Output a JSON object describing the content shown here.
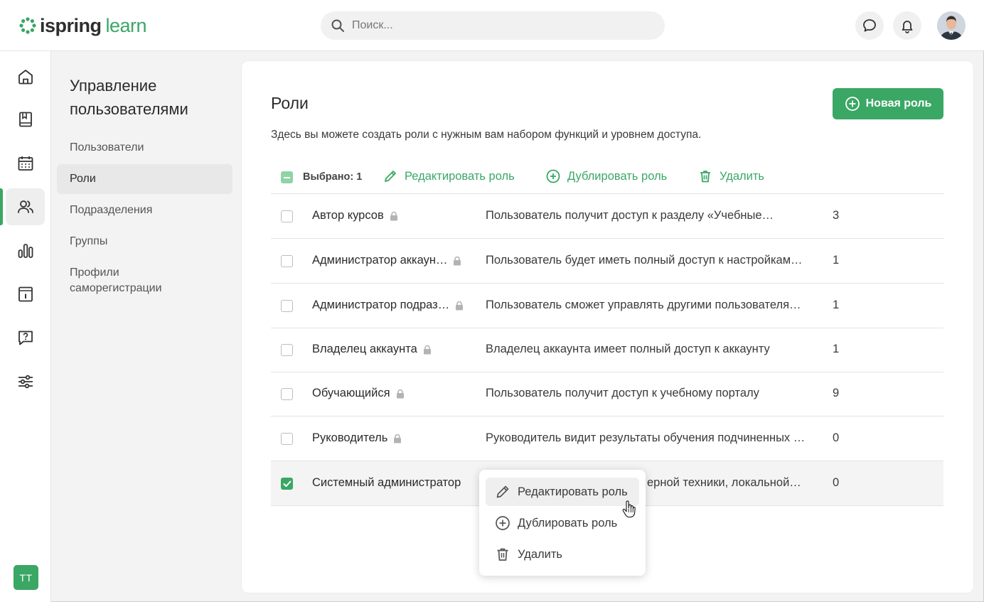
{
  "header": {
    "logo_part1": "ispring",
    "logo_part2": "learn",
    "search_placeholder": "Поиск...",
    "icons": [
      "chat-icon",
      "bell-icon",
      "user-avatar"
    ]
  },
  "rail": {
    "items": [
      "home-icon",
      "book-icon",
      "calendar-icon",
      "users-icon",
      "reports-icon",
      "info-icon",
      "help-icon",
      "settings-sliders-icon"
    ],
    "active": "users-icon",
    "user_badge": "ТТ"
  },
  "section": {
    "title": "Управление пользователями",
    "nav": [
      {
        "label": "Пользователи"
      },
      {
        "label": "Роли"
      },
      {
        "label": "Подразделения"
      },
      {
        "label": "Группы"
      },
      {
        "label": "Профили саморегистрации"
      }
    ],
    "active": "Роли"
  },
  "main": {
    "title": "Роли",
    "description": "Здесь вы можете создать роли с нужным вам набором функций и уровнем доступа.",
    "new_role_label": "Новая роль",
    "toolbar": {
      "selected_label": "Выбрано: 1",
      "edit_label": "Редактировать роль",
      "duplicate_label": "Дублировать роль",
      "delete_label": "Удалить"
    },
    "roles": [
      {
        "name": "Автор курсов",
        "locked": true,
        "description": "Пользователь получит доступ к разделу «Учебные…",
        "count": "3",
        "checked": false
      },
      {
        "name": "Администратор аккаун…",
        "locked": true,
        "description": "Пользователь будет иметь полный доступ к настройкам…",
        "count": "1",
        "checked": false
      },
      {
        "name": "Администратор подраз…",
        "locked": true,
        "description": "Пользователь сможет управлять другими пользователя…",
        "count": "1",
        "checked": false
      },
      {
        "name": "Владелец аккаунта",
        "locked": true,
        "description": "Владелец аккаунта имеет полный доступ к аккаунту",
        "count": "1",
        "checked": false
      },
      {
        "name": "Обучающийся",
        "locked": true,
        "description": "Пользователь получит доступ к учебному порталу",
        "count": "9",
        "checked": false
      },
      {
        "name": "Руководитель",
        "locked": true,
        "description": "Руководитель видит результаты обучения подчиненных …",
        "count": "0",
        "checked": false
      },
      {
        "name": "Системный администратор",
        "locked": false,
        "description": "ерной техники, локальной…",
        "count": "0",
        "checked": true
      }
    ]
  },
  "context_menu": {
    "items": [
      {
        "label": "Редактировать роль",
        "icon": "pencil-icon"
      },
      {
        "label": "Дублировать роль",
        "icon": "plus-circle-icon"
      },
      {
        "label": "Удалить",
        "icon": "trash-icon"
      }
    ]
  },
  "colors": {
    "accent": "#3aa765",
    "text": "#2b2b2b"
  }
}
